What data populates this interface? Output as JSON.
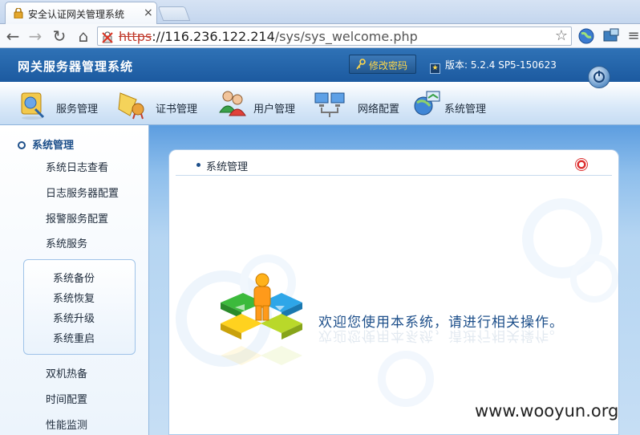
{
  "browser": {
    "tab_title": "安全认证网关管理系统",
    "tab_close": "×",
    "url_protocol": "https",
    "url_host": "://116.236.122.214",
    "url_path": "/sys/sys_welcome.php",
    "star_glyph": "☆"
  },
  "app": {
    "name": "网关服务器管理系统",
    "change_password_label": "修改密码",
    "version_text": "版本: 5.2.4 SP5-150623",
    "modules": [
      {
        "label": "服务管理",
        "icon": "service-management-icon"
      },
      {
        "label": "证书管理",
        "icon": "certificate-management-icon"
      },
      {
        "label": "用户管理",
        "icon": "user-management-icon"
      },
      {
        "label": "网络配置",
        "icon": "network-config-icon"
      },
      {
        "label": "系统管理",
        "icon": "system-management-icon"
      }
    ]
  },
  "sidebar": {
    "title": "系统管理",
    "items": [
      "系统日志查看",
      "日志服务器配置",
      "报警服务配置",
      "系统服务"
    ],
    "sub_items": [
      "系统备份",
      "系统恢复",
      "系统升级",
      "系统重启"
    ],
    "items_after": [
      "双机热备",
      "时间配置",
      "性能监测"
    ]
  },
  "panel": {
    "title": "系统管理",
    "welcome_text": "欢迎您使用本系统，请进行相关操作。"
  },
  "watermark": "www.wooyun.org",
  "colors": {
    "header_blue": "#1c5aa0",
    "accent_yellow": "#ffd84a",
    "text_dark_blue": "#1d4f8a"
  }
}
